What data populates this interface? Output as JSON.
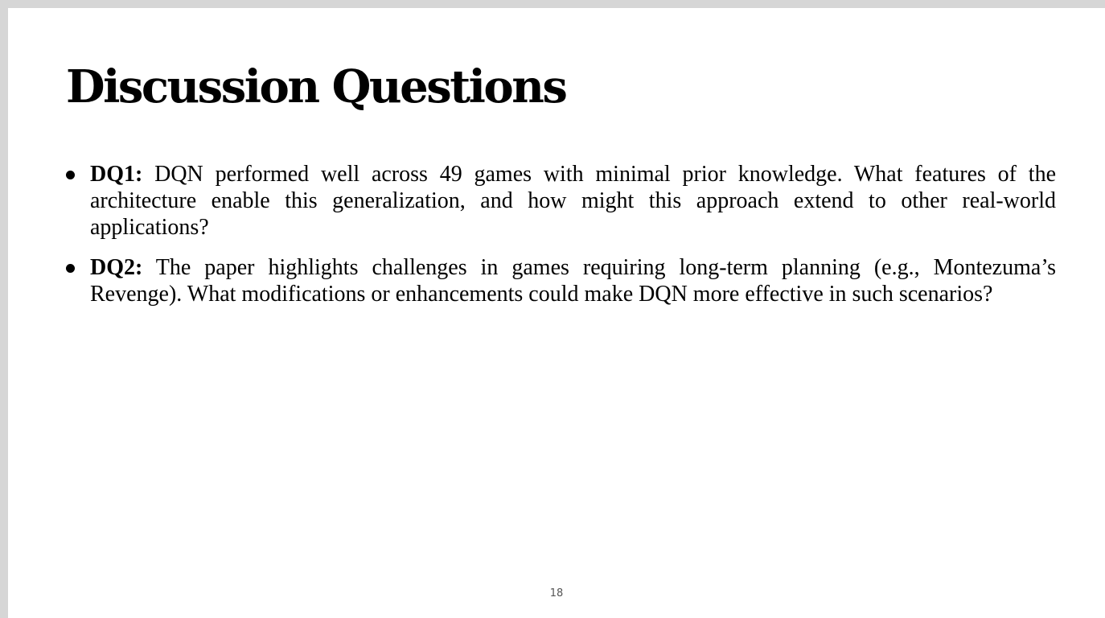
{
  "slide": {
    "title": "Discussion Questions",
    "page_number": "18",
    "bullets": [
      {
        "label": "DQ1:",
        "text": " DQN performed well across 49 games with minimal prior knowledge. What features of the architecture enable this generalization, and how might this approach extend to other real-world applications?"
      },
      {
        "label": "DQ2:",
        "text": " The paper highlights challenges in games requiring long-term planning (e.g., Montezuma’s Revenge). What modifications or enhancements could make DQN more effective in such scenarios?"
      }
    ]
  }
}
